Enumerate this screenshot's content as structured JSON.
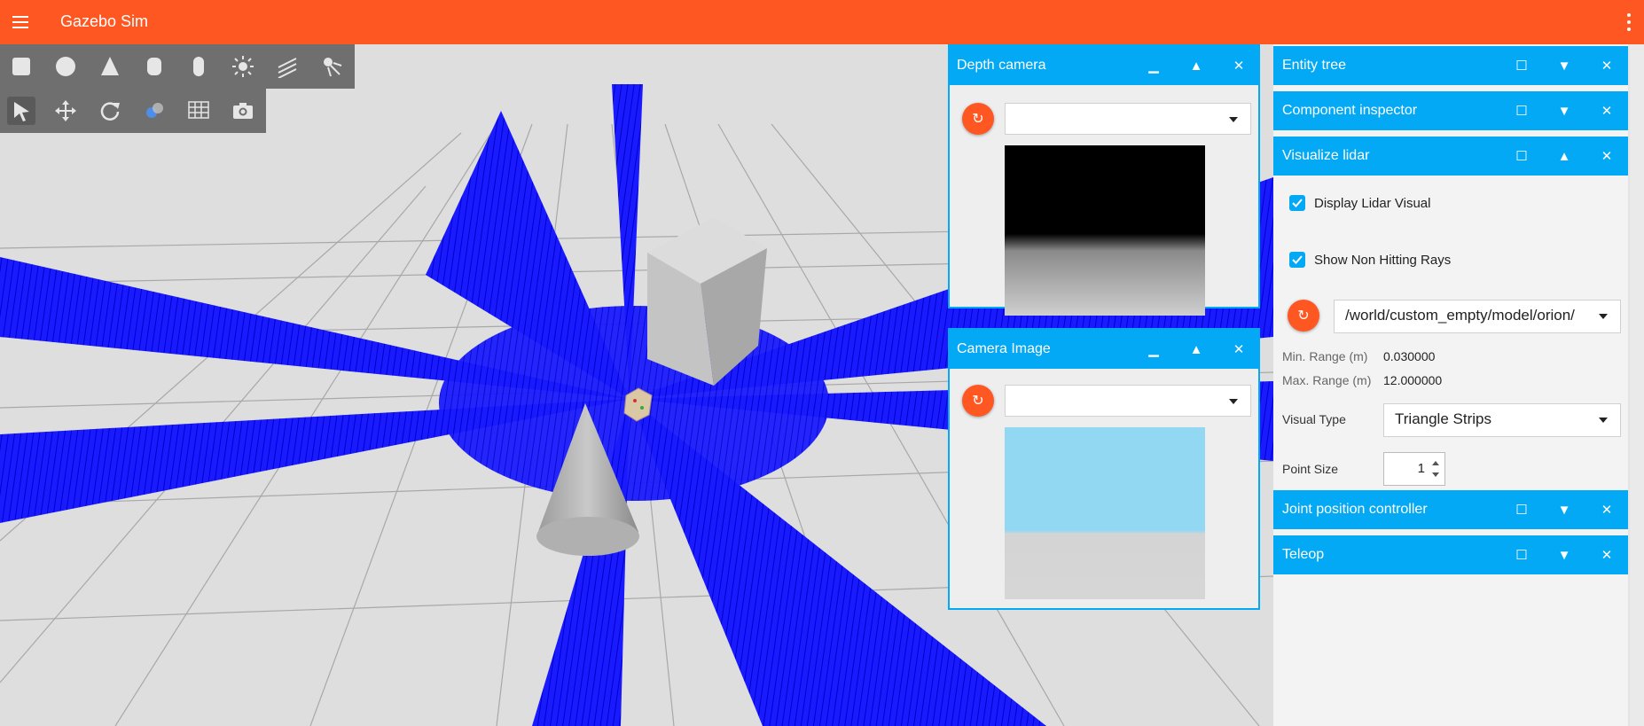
{
  "app": {
    "title": "Gazebo Sim"
  },
  "toolbar": {
    "shapes": [
      "box-icon",
      "sphere-icon",
      "cone-icon",
      "cylinder-icon",
      "capsule-icon",
      "sun-light-icon",
      "directional-light-icon",
      "spot-light-icon"
    ],
    "transform": [
      "select-icon",
      "translate-icon",
      "rotate-icon",
      "view-angle-icon",
      "grid-config-icon",
      "screenshot-icon"
    ]
  },
  "depth_camera": {
    "title": "Depth camera",
    "topic": ""
  },
  "camera_image": {
    "title": "Camera Image",
    "topic": ""
  },
  "dock": {
    "entity_tree": "Entity tree",
    "component_inspector": "Component inspector",
    "visualize_lidar": {
      "title": "Visualize lidar",
      "display_lidar_visual": "Display Lidar Visual",
      "show_non_hitting_rays": "Show Non Hitting Rays",
      "topic": "/world/custom_empty/model/orion/",
      "min_range_label": "Min. Range (m)",
      "min_range_value": "0.030000",
      "max_range_label": "Max. Range (m)",
      "max_range_value": "12.000000",
      "visual_type_label": "Visual Type",
      "visual_type_value": "Triangle Strips",
      "point_size_label": "Point Size",
      "point_size_value": "1"
    },
    "joint_position_controller": "Joint position controller",
    "teleop": "Teleop"
  },
  "colors": {
    "accent_orange": "#ff5722",
    "accent_blue": "#03a9f4",
    "lidar_blue": "#0000ff",
    "sky": "#93d8f2"
  }
}
